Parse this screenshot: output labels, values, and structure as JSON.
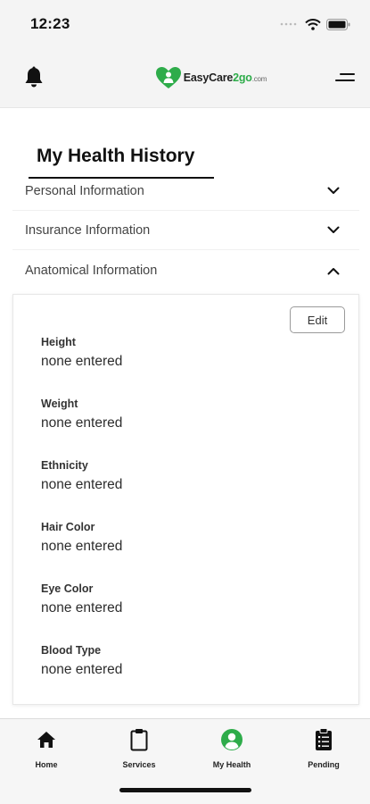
{
  "status_bar": {
    "time": "12:23"
  },
  "header": {
    "logo_prefix": "EasyCare",
    "logo_accent": "2go",
    "logo_domain": ".com",
    "brand_color": "#2eac4a"
  },
  "page": {
    "title": "My Health History"
  },
  "sections": [
    {
      "label": "Personal Information",
      "expanded": false
    },
    {
      "label": "Insurance Information",
      "expanded": false
    },
    {
      "label": "Anatomical Information",
      "expanded": true
    }
  ],
  "anatomical": {
    "edit_label": "Edit",
    "fields": [
      {
        "label": "Height",
        "value": "none entered"
      },
      {
        "label": "Weight",
        "value": "none entered"
      },
      {
        "label": "Ethnicity",
        "value": "none entered"
      },
      {
        "label": "Hair Color",
        "value": "none entered"
      },
      {
        "label": "Eye Color",
        "value": "none entered"
      },
      {
        "label": "Blood Type",
        "value": "none entered"
      }
    ]
  },
  "bottom_nav": {
    "items": [
      {
        "label": "Home",
        "icon": "home-icon"
      },
      {
        "label": "Services",
        "icon": "clipboard-icon"
      },
      {
        "label": "My Health",
        "icon": "user-circle-icon",
        "active": true
      },
      {
        "label": "Pending",
        "icon": "clipboard-list-icon"
      }
    ],
    "active_color": "#2eac4a"
  }
}
